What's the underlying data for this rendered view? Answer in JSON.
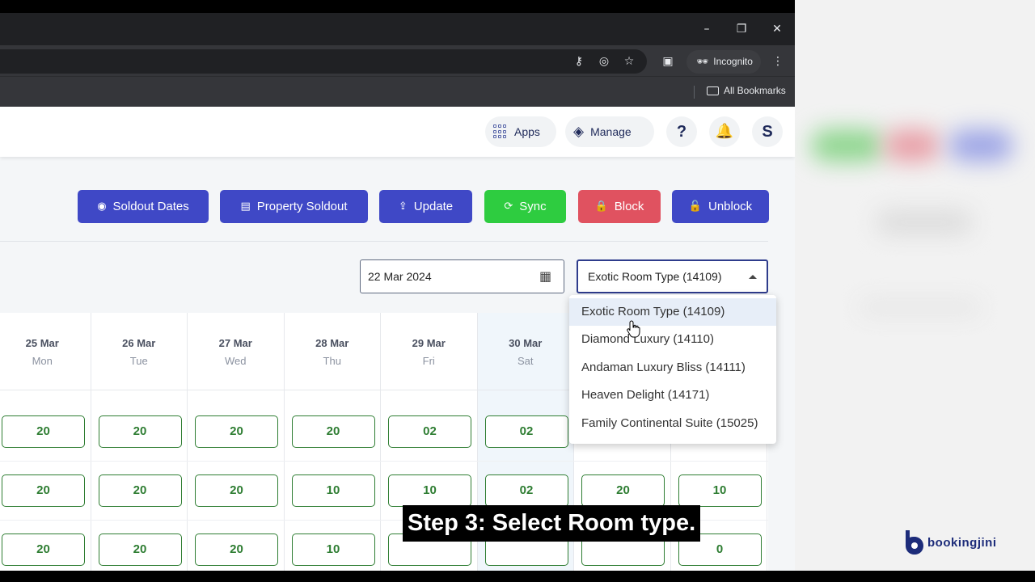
{
  "browser": {
    "window_controls": [
      "–",
      "❐",
      "✕"
    ],
    "incognito_label": "Incognito",
    "bookmarks_label": "All Bookmarks"
  },
  "header": {
    "apps_label": "Apps",
    "manage_label": "Manage",
    "help_label": "?",
    "avatar_initial": "S"
  },
  "actions": [
    {
      "label": "Soldout Dates",
      "icon": "eye-icon",
      "color": "#3f48c6"
    },
    {
      "label": "Property Soldout",
      "icon": "archive-icon",
      "color": "#3f48c6"
    },
    {
      "label": "Update",
      "icon": "upload-icon",
      "color": "#3f48c6"
    },
    {
      "label": "Sync",
      "icon": "sync-icon",
      "color": "#2ecc40"
    },
    {
      "label": "Block",
      "icon": "lock-icon",
      "color": "#e05260"
    },
    {
      "label": "Unblock",
      "icon": "unlock-icon",
      "color": "#3f48c6"
    }
  ],
  "filters": {
    "date_value": "22 Mar 2024",
    "room_select_value": "Exotic Room Type (14109)"
  },
  "dropdown": {
    "options": [
      "Exotic Room Type (14109)",
      "Diamond Luxury (14110)",
      "Andaman Luxury Bliss (14111)",
      "Heaven Delight (14171)",
      "Family Continental Suite (15025)"
    ],
    "selected_index": 0
  },
  "calendar": {
    "days": [
      {
        "date": "25 Mar",
        "day": "Mon"
      },
      {
        "date": "26 Mar",
        "day": "Tue"
      },
      {
        "date": "27 Mar",
        "day": "Wed"
      },
      {
        "date": "28 Mar",
        "day": "Thu"
      },
      {
        "date": "29 Mar",
        "day": "Fri"
      },
      {
        "date": "30 Mar",
        "day": "Sat"
      },
      {
        "date": "",
        "day": ""
      },
      {
        "date": "",
        "day": ""
      }
    ],
    "rows": [
      [
        "20",
        "20",
        "20",
        "20",
        "02",
        "02",
        "",
        ""
      ],
      [
        "20",
        "20",
        "20",
        "10",
        "10",
        "02",
        "20",
        "10"
      ],
      [
        "20",
        "20",
        "20",
        "10",
        "",
        "",
        "",
        "0"
      ]
    ]
  },
  "caption": "Step 3: Select Room type.",
  "logo_text": "bookingjini",
  "colors": {
    "primary": "#3f48c6",
    "success": "#2ecc40",
    "danger": "#e05260",
    "cell_green": "#2e7d32"
  }
}
